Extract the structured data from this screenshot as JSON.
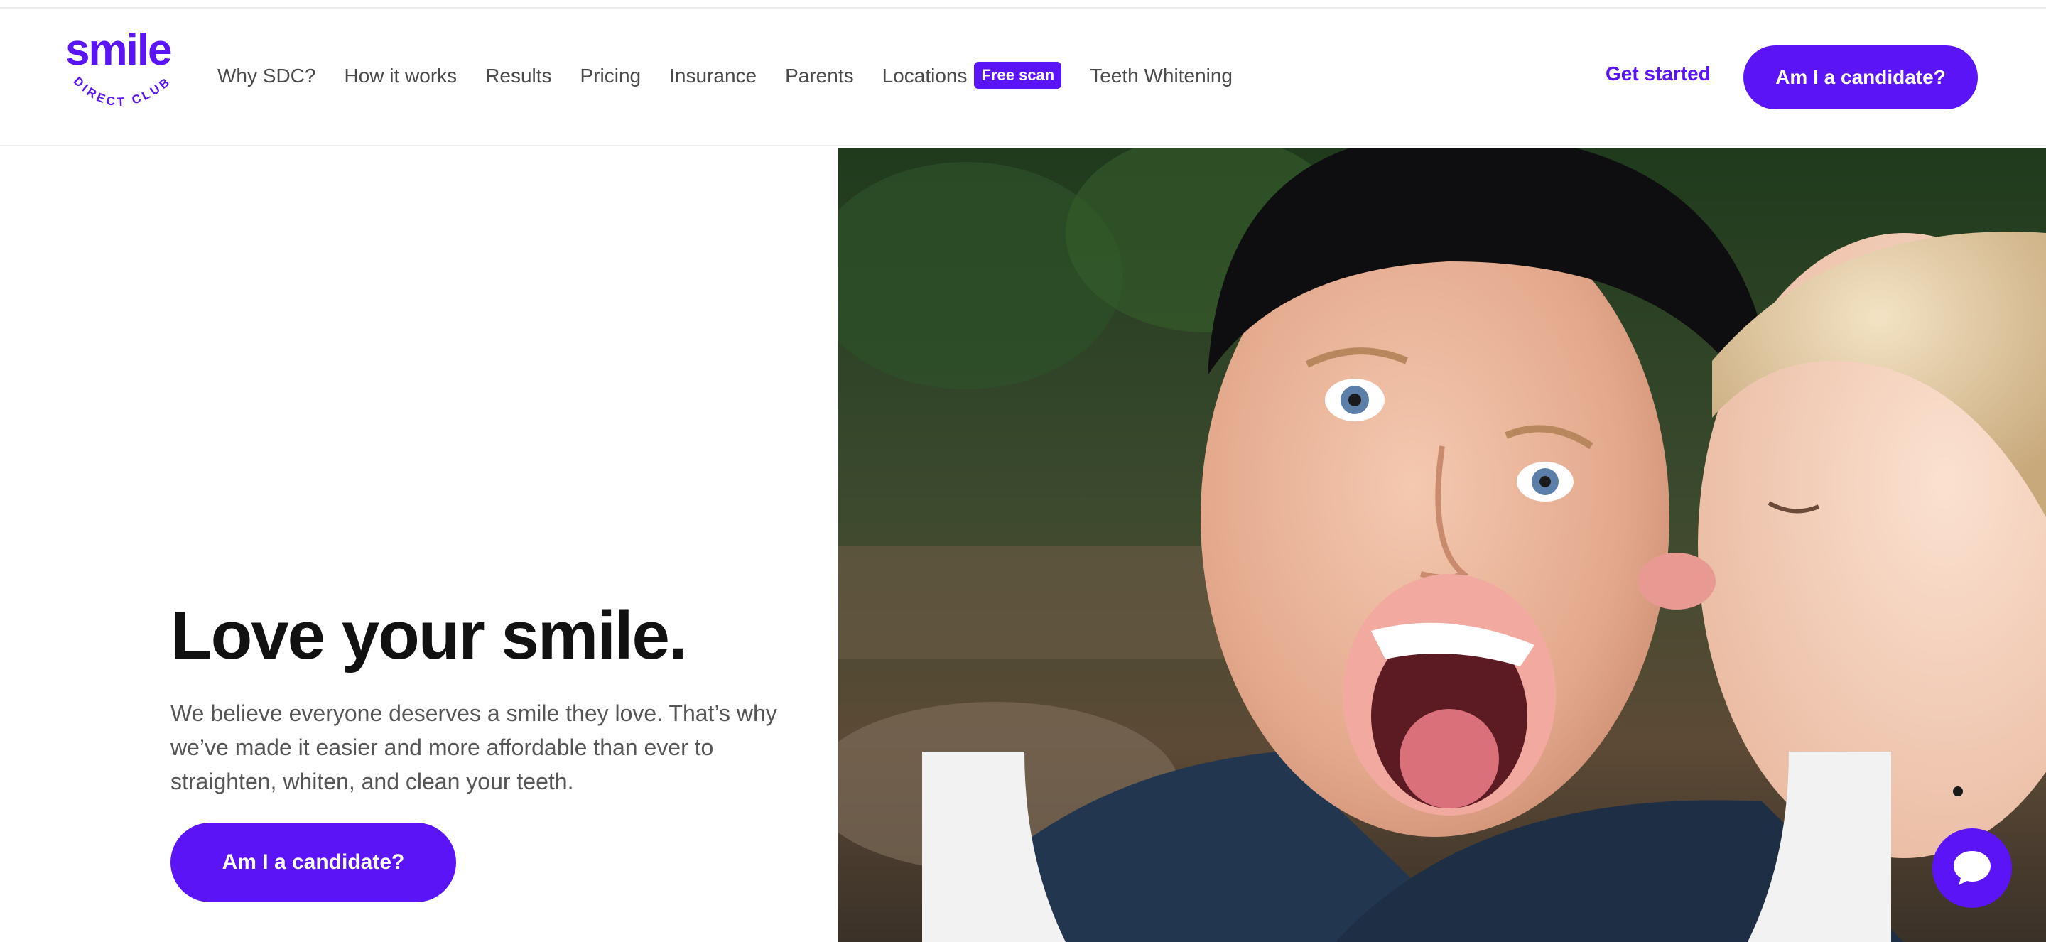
{
  "brand": {
    "logo_text": "smile",
    "logo_subtext": "DIRECT CLUB",
    "color": "#5a14f5"
  },
  "nav": {
    "items": [
      {
        "label": "Why SDC?"
      },
      {
        "label": "How it works"
      },
      {
        "label": "Results"
      },
      {
        "label": "Pricing"
      },
      {
        "label": "Insurance"
      },
      {
        "label": "Parents"
      },
      {
        "label": "Locations"
      }
    ],
    "badge": "Free scan",
    "last_item": "Teeth Whitening",
    "get_started": "Get started",
    "cta": "Am I a candidate?"
  },
  "hero": {
    "title": "Love your smile.",
    "subtitle": "We believe everyone deserves a smile they love. That’s why we’ve made it easier and more affordable than ever to straighten, whiten, and clean your teeth.",
    "cta": "Am I a candidate?",
    "image_icon": "couple-photo"
  },
  "chat": {
    "icon": "chat-bubble-icon"
  }
}
